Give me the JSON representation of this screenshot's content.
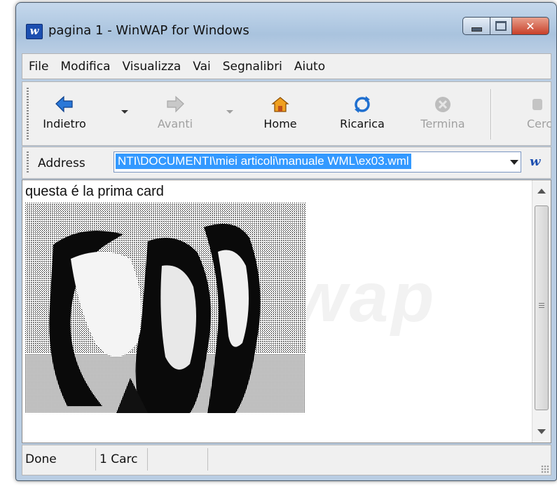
{
  "window": {
    "title": "pagina 1 - WinWAP for Windows",
    "app_icon_letter": "w"
  },
  "menu": {
    "items": [
      "File",
      "Modifica",
      "Visualizza",
      "Vai",
      "Segnalibri",
      "Aiuto"
    ]
  },
  "toolbar": {
    "back_label": "Indietro",
    "forward_label": "Avanti",
    "home_label": "Home",
    "reload_label": "Ricarica",
    "stop_label": "Termina",
    "search_label": "Cerc"
  },
  "address": {
    "label": "Address",
    "value": "NTI\\DOCUMENTI\\miei articoli\\manuale WML\\ex03.wml"
  },
  "content": {
    "text": "questa é la prima card",
    "watermark": "wap"
  },
  "status": {
    "state": "Done",
    "cards": "1 Carc"
  },
  "colors": {
    "selection": "#3399ff",
    "window_frame": "#a9c3de",
    "toolbar_bg": "#f0f0f0"
  }
}
